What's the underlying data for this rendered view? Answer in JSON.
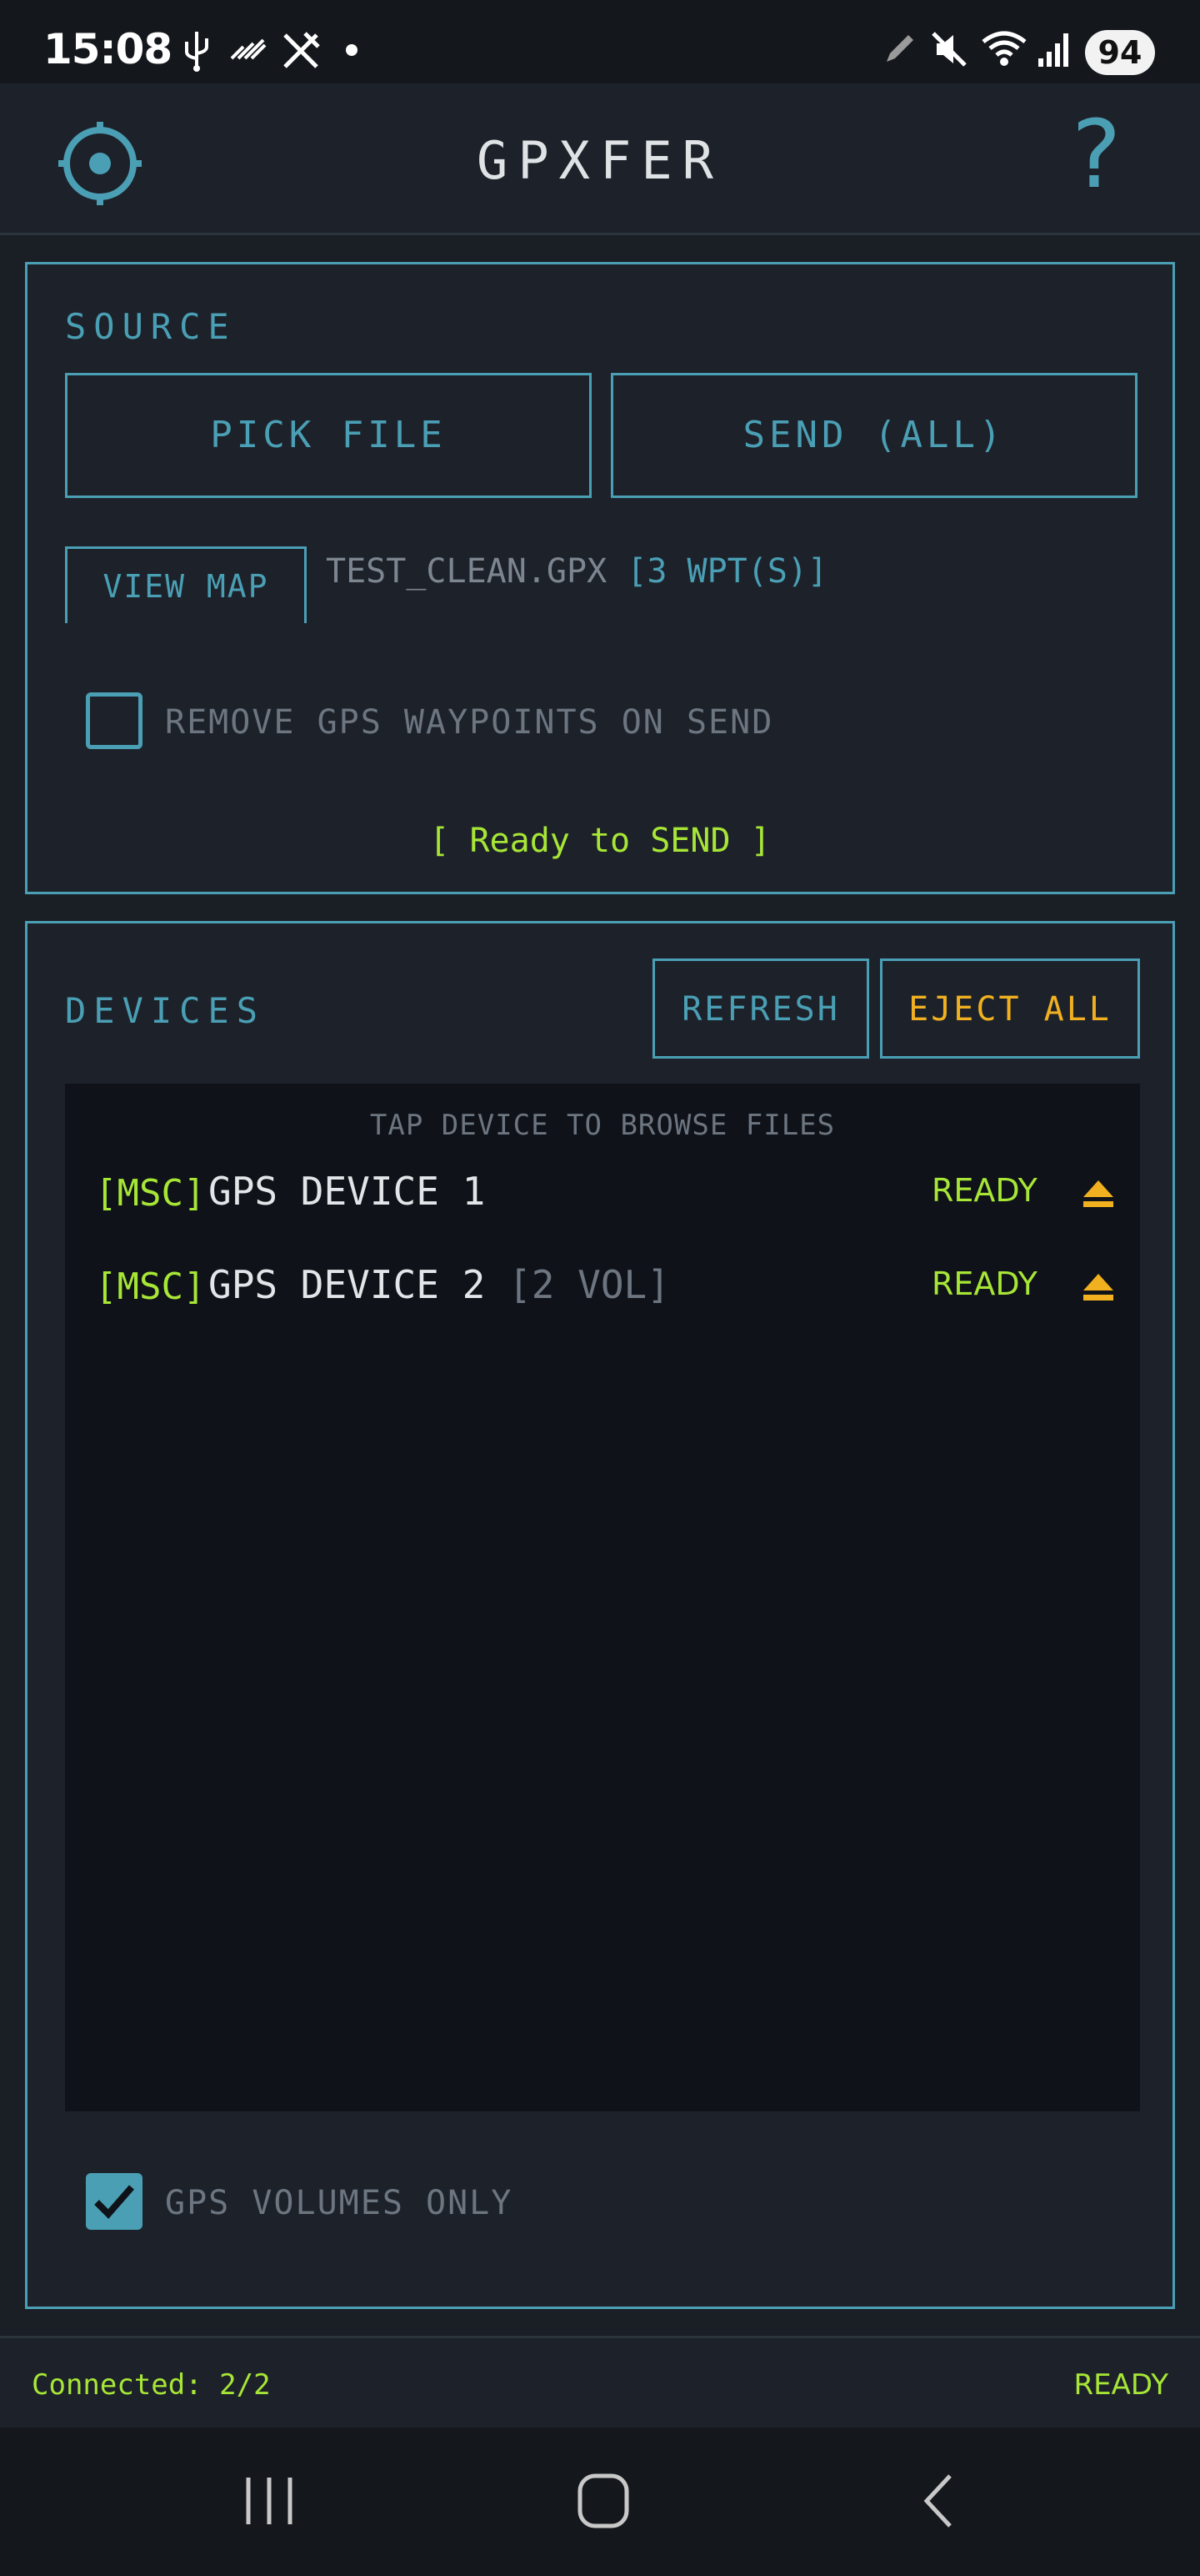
{
  "status_bar": {
    "time": "15:08",
    "battery": "94",
    "left_icons": [
      "usb-icon",
      "signal-stripes-icon",
      "tools-off-icon",
      "dot-icon"
    ],
    "right_icons": [
      "pen-icon",
      "mute-icon",
      "wifi-icon",
      "cell-signal-icon"
    ]
  },
  "header": {
    "title": "GPXFER",
    "settings_icon": "gear-icon",
    "help_label": "?"
  },
  "source": {
    "section_label": "SOURCE",
    "pick_file_label": "PICK FILE",
    "send_label": "SEND (ALL)",
    "view_map_label": "VIEW MAP",
    "filename": "TEST_CLEAN.GPX",
    "waypoints": "[3 WPT(S)]",
    "remove_waypoints_label": "REMOVE GPS WAYPOINTS ON SEND",
    "remove_waypoints_checked": false,
    "ready_message": "[ Ready to SEND ]"
  },
  "devices": {
    "section_label": "DEVICES",
    "refresh_label": "REFRESH",
    "eject_all_label": "EJECT ALL",
    "hint": "TAP DEVICE TO BROWSE FILES",
    "items": [
      {
        "tag": "[MSC]",
        "name": "GPS DEVICE 1",
        "volumes": "",
        "status": "READY"
      },
      {
        "tag": "[MSC]",
        "name": "GPS DEVICE 2",
        "volumes": "[2 VOL]",
        "status": "READY"
      }
    ],
    "gps_only_label": "GPS VOLUMES ONLY",
    "gps_only_checked": true
  },
  "footer": {
    "connected": "Connected: 2/2",
    "status": "READY"
  },
  "colors": {
    "accent": "#4a9fb5",
    "ok": "#a7e636",
    "warn": "#f0b020",
    "background": "#1a1e25"
  }
}
